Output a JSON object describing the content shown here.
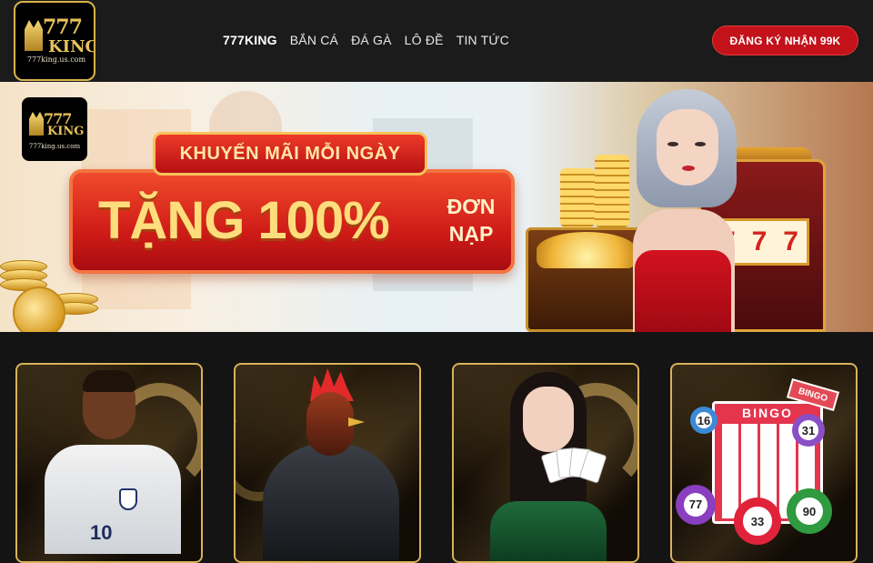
{
  "header": {
    "logo": {
      "brand": "777",
      "brand2": "KING",
      "url": "777king.us.com"
    },
    "nav": [
      {
        "label": "777KING"
      },
      {
        "label": "BẮN CÁ"
      },
      {
        "label": "ĐÁ GÀ"
      },
      {
        "label": "LÔ ĐỀ"
      },
      {
        "label": "TIN TỨC"
      }
    ],
    "cta_label": "ĐĂNG KÝ NHẬN 99K"
  },
  "banner": {
    "logo": {
      "brand": "777",
      "brand2": "KING",
      "url": "777king.us.com"
    },
    "promo_top": "KHUYẾN MÃI MỖI NGÀY",
    "promo_main": "TẶNG 100%",
    "promo_side": "ĐƠN NẠP",
    "slot_symbols": [
      "7",
      "7",
      "7"
    ]
  },
  "cards": {
    "player_number": "10",
    "bingo_title": "BINGO",
    "bingo_tag": "BINGO",
    "balls": [
      "77",
      "33",
      "90",
      "31",
      "16"
    ]
  },
  "colors": {
    "header_bg": "#1b1b1b",
    "accent_red": "#c3121a",
    "gold": "#d9b25a"
  }
}
